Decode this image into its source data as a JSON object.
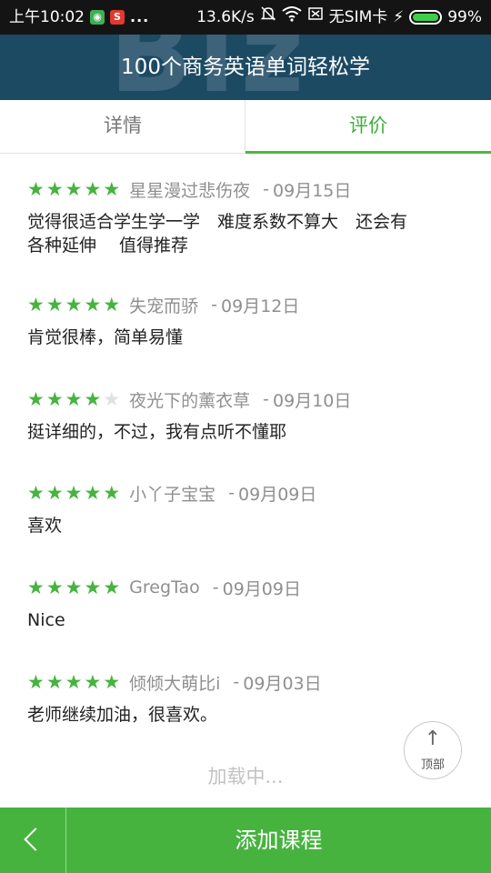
{
  "status_bar": {
    "time": "上午10:02",
    "dots": "...",
    "speed": "13.6K/s",
    "sim": "无SIM卡",
    "battery": "99%",
    "battery_level": 0.99
  },
  "header": {
    "title": "100个商务英语单词轻松学",
    "watermark": "Biz"
  },
  "tabs": [
    {
      "label": "详情",
      "active": false
    },
    {
      "label": "评价",
      "active": true
    }
  ],
  "reviews": [
    {
      "rating": 5,
      "user": "星星漫过悲伤夜",
      "sep": "-",
      "date": "09月15日",
      "text": "觉得很适合学生学一学　难度系数不算大　还会有\n各种延伸　 值得推荐"
    },
    {
      "rating": 5,
      "user": "失宠而骄",
      "sep": "-",
      "date": "09月12日",
      "text": "肯觉很棒，简单易懂"
    },
    {
      "rating": 4,
      "user": "夜光下的薰衣草",
      "sep": "-",
      "date": "09月10日",
      "text": "挺详细的，不过，我有点听不懂耶"
    },
    {
      "rating": 5,
      "user": "小丫子宝宝",
      "sep": "-",
      "date": "09月09日",
      "text": "喜欢"
    },
    {
      "rating": 5,
      "user": "GregTao",
      "sep": "-",
      "date": "09月09日",
      "text": "Nice"
    },
    {
      "rating": 5,
      "user": "倾倾大萌比i",
      "sep": "-",
      "date": "09月03日",
      "text": "老师继续加油，很喜欢。"
    }
  ],
  "loading_text": "加载中...",
  "top_button": {
    "arrow": "↑",
    "label": "顶部"
  },
  "bottom_bar": {
    "back_icon": "chevron-left-icon",
    "add_label": "添加课程"
  },
  "colors": {
    "accent_green": "#46b33f",
    "header_blue": "#1c4a63",
    "tab_active": "#3fae3a"
  }
}
